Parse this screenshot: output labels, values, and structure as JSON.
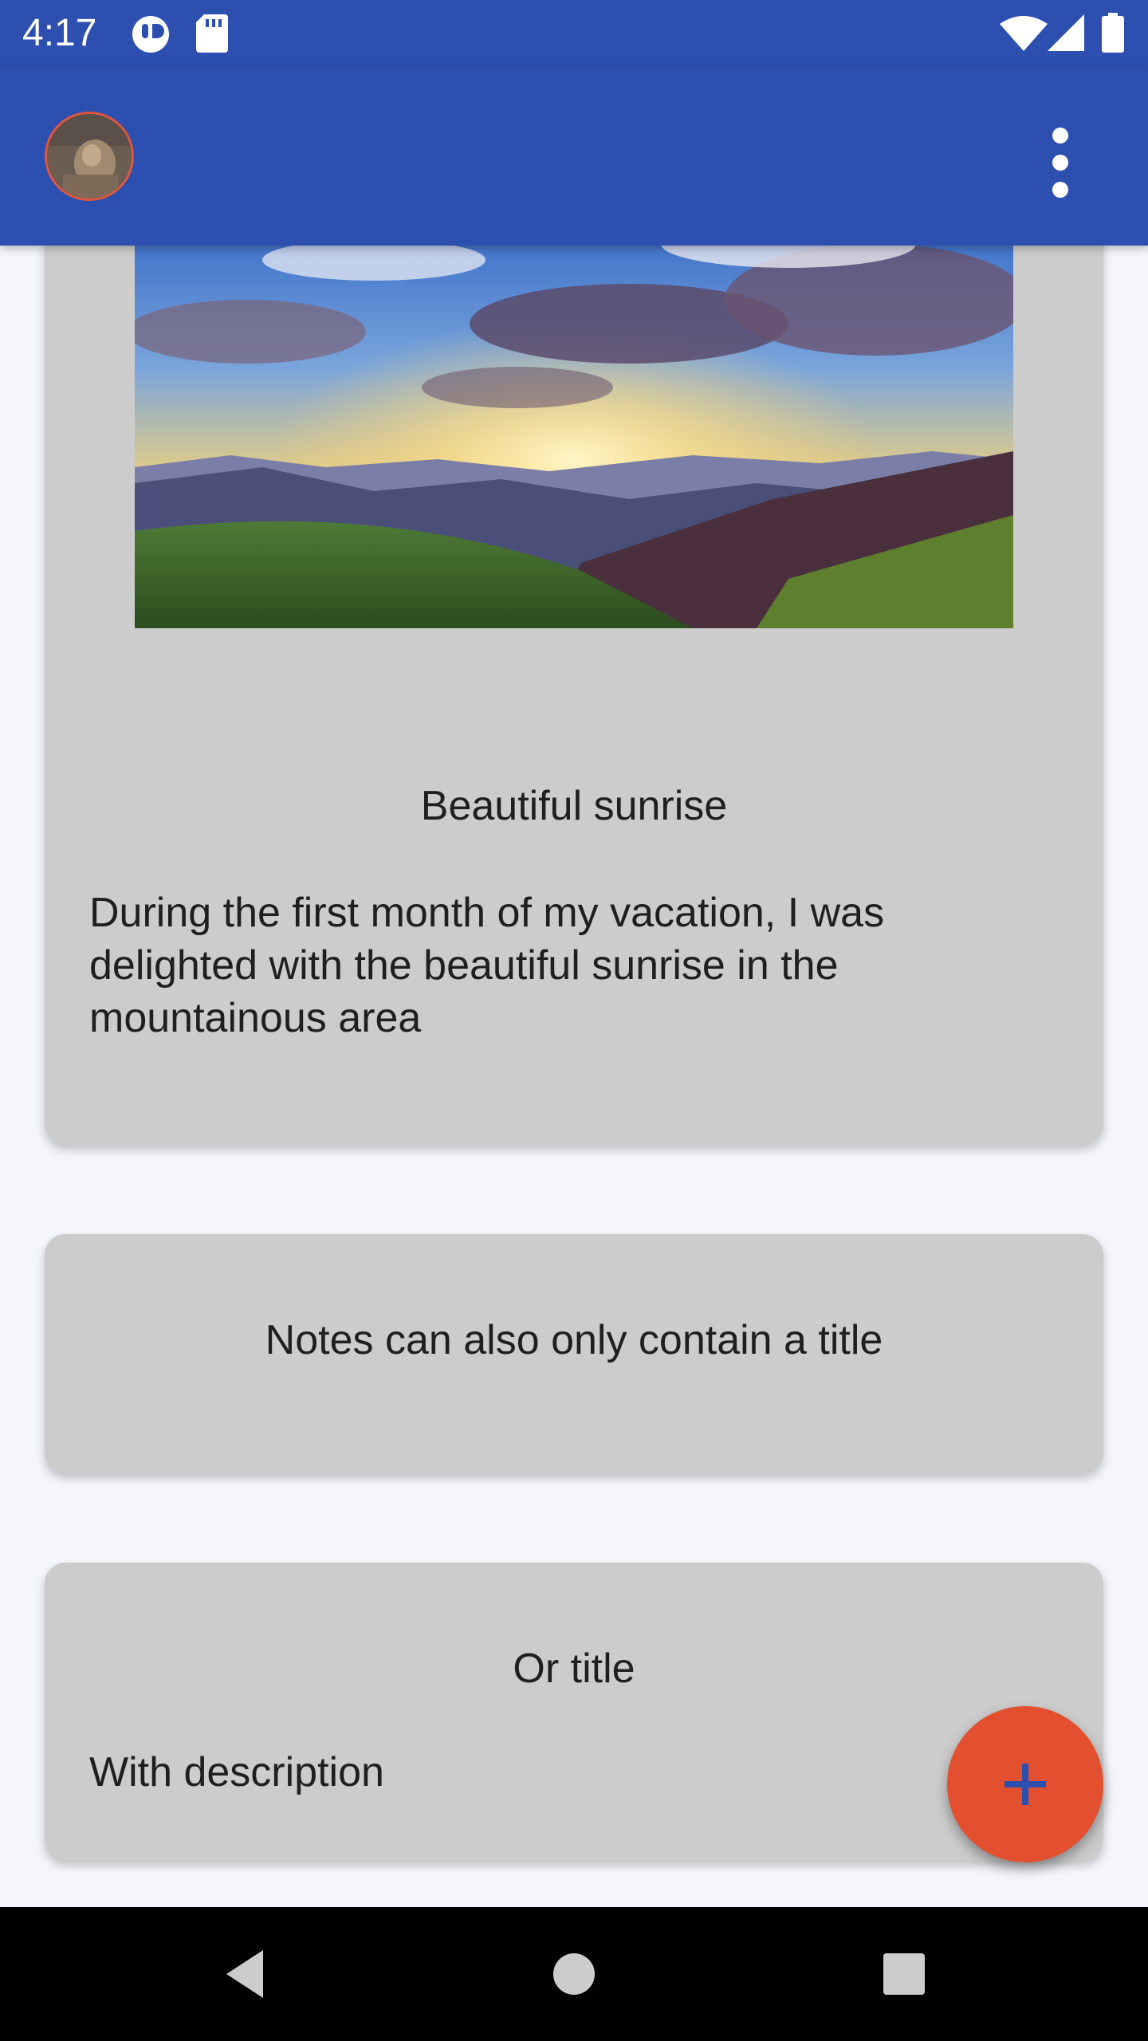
{
  "status_bar": {
    "time": "4:17",
    "left_icons": [
      "app-notification-icon",
      "sd-card-icon"
    ],
    "right_icons": [
      "wifi-icon",
      "cell-signal-icon",
      "battery-icon"
    ]
  },
  "app_bar": {
    "avatar_icon": "avatar-image",
    "menu_icon": "more-vert-icon"
  },
  "notes": [
    {
      "image": "sunrise-mountains-image",
      "title": "Beautiful sunrise",
      "description": "During the first month of my vacation, I was delighted with the beautiful sunrise in the mountainous area"
    },
    {
      "title": "Notes can also only contain a title"
    },
    {
      "title": "Or title",
      "description": "With description"
    }
  ],
  "fab": {
    "icon": "plus-icon"
  },
  "nav_bar": {
    "buttons": [
      "back-icon",
      "home-icon",
      "recents-icon"
    ]
  },
  "colors": {
    "primary": "#2d4fb0",
    "accent": "#e2502f",
    "card": "#cccccc",
    "background": "#f5f6fb"
  }
}
